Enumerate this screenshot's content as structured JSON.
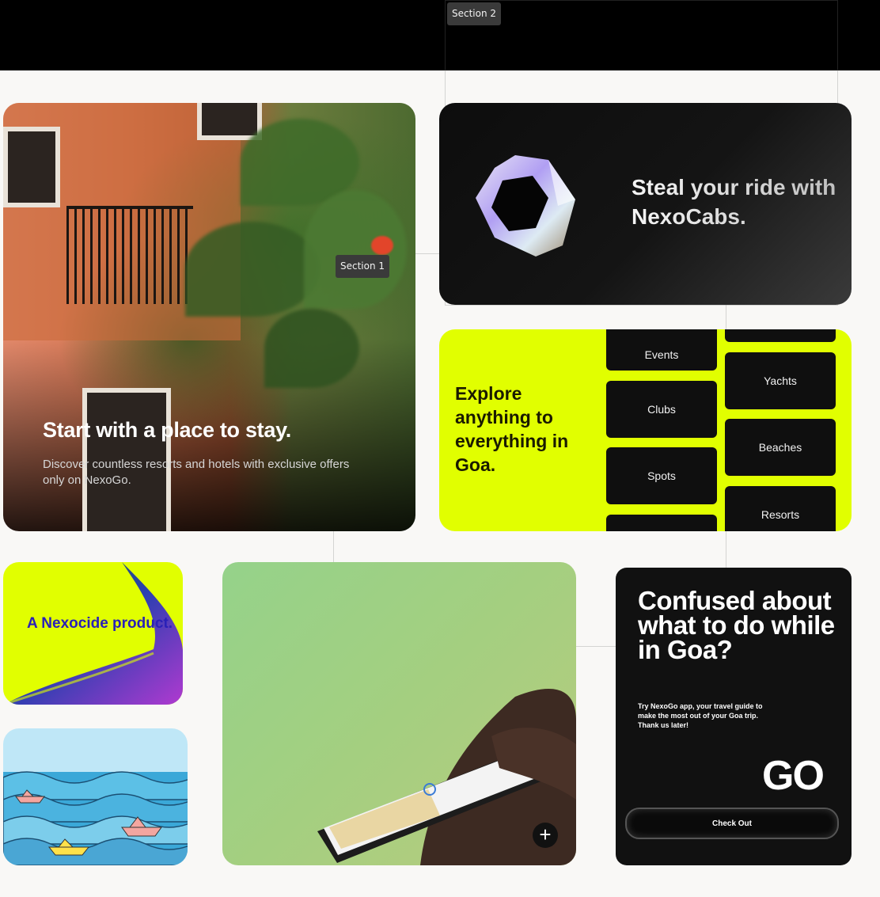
{
  "frames": {
    "section2": "Section 2",
    "section1": "Section 1"
  },
  "hero": {
    "title": "Start with a place to stay.",
    "subtitle": "Discover countless resorts and hotels with exclusive offers only on NexoGo."
  },
  "ride": {
    "title": "Steal your ride with NexoCabs."
  },
  "explore": {
    "title": "Explore anything to everything in Goa.",
    "left_chips": [
      "Events",
      "Clubs",
      "Spots"
    ],
    "right_chips": [
      "Yachts",
      "Beaches",
      "Resorts"
    ]
  },
  "nexocide": {
    "text": "A Nexocide product."
  },
  "confused": {
    "title": "Confused about what to do while in Goa?",
    "subtitle": "Try NexoGo app, your travel guide to make the most out of your Goa trip. Thank us later!",
    "logo": "GO",
    "cta": "Check Out"
  },
  "colors": {
    "accent": "#e1ff00",
    "dark": "#111111",
    "nexocide_text": "#2a20b8"
  }
}
